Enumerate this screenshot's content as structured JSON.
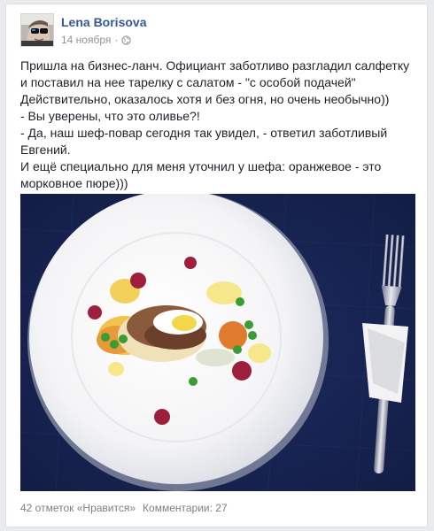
{
  "post": {
    "author": "Lena Borisova",
    "date": "14 ноября",
    "separator": "·",
    "privacy_icon": "globe-icon",
    "text_lines": [
      "Пришла на бизнес-ланч. Официант заботливо разгладил салфетку и поставил на нее тарелку с салатом - \"с особой подачей\"",
      "Действительно, оказалось хотя и без огня, но очень необычно))",
      "- Вы уверены, что это оливье?!",
      "- Да, наш шеф-повар сегодня так увидел, - ответил заботливый Евгений.",
      "И ещё специально для меня уточнил у шефа: оранжевое - это морковное пюре)))"
    ],
    "photo": "plated-salad-photo"
  },
  "footer": {
    "likes": "42 отметок «Нравится»",
    "comments": "Комментарии: 27"
  },
  "colors": {
    "author_link": "#365899",
    "meta_gray": "#90949c",
    "tablecloth": "#162452",
    "page_bg": "#e9ebee"
  }
}
